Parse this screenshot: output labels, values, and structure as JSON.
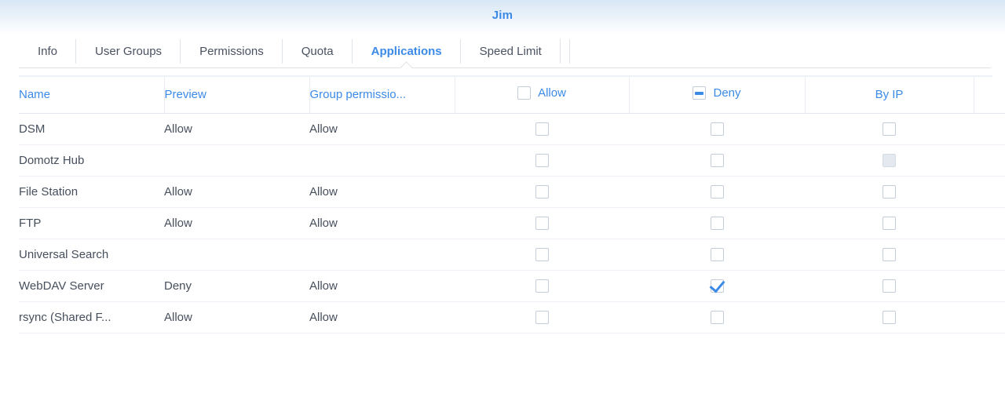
{
  "window": {
    "title": "Jim"
  },
  "tabs": [
    {
      "label": "Info",
      "active": false
    },
    {
      "label": "User Groups",
      "active": false
    },
    {
      "label": "Permissions",
      "active": false
    },
    {
      "label": "Quota",
      "active": false
    },
    {
      "label": "Applications",
      "active": true
    },
    {
      "label": "Speed Limit",
      "active": false
    }
  ],
  "table": {
    "columns": [
      {
        "key": "name",
        "label": "Name",
        "type": "text"
      },
      {
        "key": "preview",
        "label": "Preview",
        "type": "text"
      },
      {
        "key": "group",
        "label": "Group permissio...",
        "type": "text"
      },
      {
        "key": "allow",
        "label": "Allow",
        "type": "checkbox",
        "header_state": "unchecked",
        "header_icon": "checkbox-unchecked-icon"
      },
      {
        "key": "deny",
        "label": "Deny",
        "type": "checkbox",
        "header_state": "indeterminate",
        "header_icon": "checkbox-indeterminate-icon"
      },
      {
        "key": "byip",
        "label": "By IP",
        "type": "checkbox",
        "header_state": "none"
      },
      {
        "key": "extra",
        "label": "",
        "type": "blank"
      }
    ],
    "rows": [
      {
        "name": "DSM",
        "preview": "Allow",
        "group": "Allow",
        "allow": "unchecked",
        "deny": "unchecked",
        "byip": "unchecked"
      },
      {
        "name": "Domotz Hub",
        "preview": "",
        "group": "",
        "allow": "unchecked",
        "deny": "unchecked",
        "byip": "disabled"
      },
      {
        "name": "File Station",
        "preview": "Allow",
        "group": "Allow",
        "allow": "unchecked",
        "deny": "unchecked",
        "byip": "unchecked"
      },
      {
        "name": "FTP",
        "preview": "Allow",
        "group": "Allow",
        "allow": "unchecked",
        "deny": "unchecked",
        "byip": "unchecked"
      },
      {
        "name": "Universal Search",
        "preview": "",
        "group": "",
        "allow": "unchecked",
        "deny": "unchecked",
        "byip": "unchecked"
      },
      {
        "name": "WebDAV Server",
        "preview": "Deny",
        "group": "Allow",
        "allow": "unchecked",
        "deny": "checked",
        "byip": "unchecked"
      },
      {
        "name": "rsync (Shared F...",
        "preview": "Allow",
        "group": "Allow",
        "allow": "unchecked",
        "deny": "unchecked",
        "byip": "unchecked"
      }
    ]
  },
  "colors": {
    "accent": "#3c8ae8",
    "text": "#464f5d",
    "header_text": "#4a5160",
    "grid_line": "#eef1f7",
    "checkbox_border": "#c3ccd8",
    "disabled_fill": "#e4e9f0"
  }
}
